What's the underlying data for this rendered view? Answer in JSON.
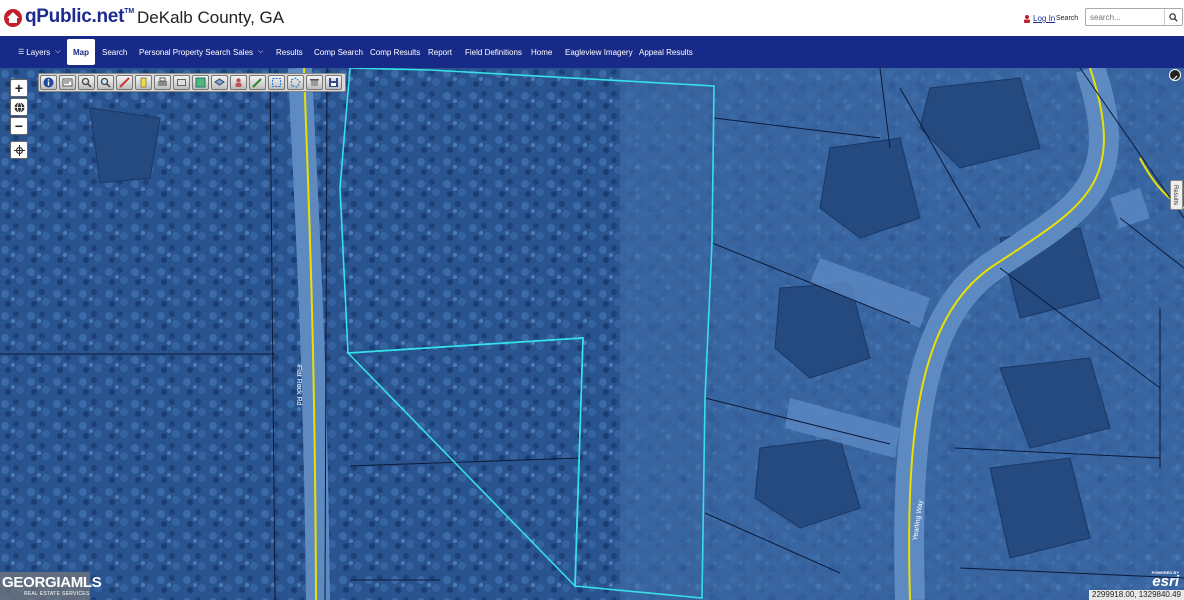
{
  "header": {
    "logo_text": "qPublic.net",
    "logo_tm": "TM",
    "county": "DeKalb County, GA",
    "login_label": "Log In",
    "search_label": "Search",
    "search_placeholder": "search..."
  },
  "nav": {
    "items": [
      {
        "label": "Layers"
      },
      {
        "label": "Map"
      },
      {
        "label": "Search"
      },
      {
        "label": "Personal Property Search"
      },
      {
        "label": "Sales"
      },
      {
        "label": "Results"
      },
      {
        "label": "Comp Search"
      },
      {
        "label": "Comp Results"
      },
      {
        "label": "Report"
      },
      {
        "label": "Field Definitions"
      },
      {
        "label": "Home"
      },
      {
        "label": "Eagleview Imagery"
      },
      {
        "label": "Appeal Results"
      }
    ]
  },
  "map": {
    "road_labels": [
      "Flat Rock Rd",
      "Yearling Way"
    ],
    "results_tab": "Results",
    "watermark_main": "GEORGIAMLS",
    "watermark_sub": "REAL ESTATE SERVICES",
    "esri_powered": "POWERED BY",
    "esri_logo": "esri",
    "coordinates": "2299918.00, 1329840.49"
  },
  "colors": {
    "nav_bg": "#172a87",
    "parcel_outline": "#35e0e8",
    "road_line": "#e8e000",
    "parcel_lines": "#0d1a3a"
  },
  "toolbar_icons": [
    "info-icon",
    "identify-icon",
    "pan-icon",
    "zoom-select-icon",
    "measure-icon",
    "marker-icon",
    "print-icon",
    "screenshot-icon",
    "select-icon",
    "layers-tool-icon",
    "person-icon",
    "draw-icon",
    "select-box-icon",
    "select-poly-icon",
    "clear-icon",
    "save-icon"
  ]
}
